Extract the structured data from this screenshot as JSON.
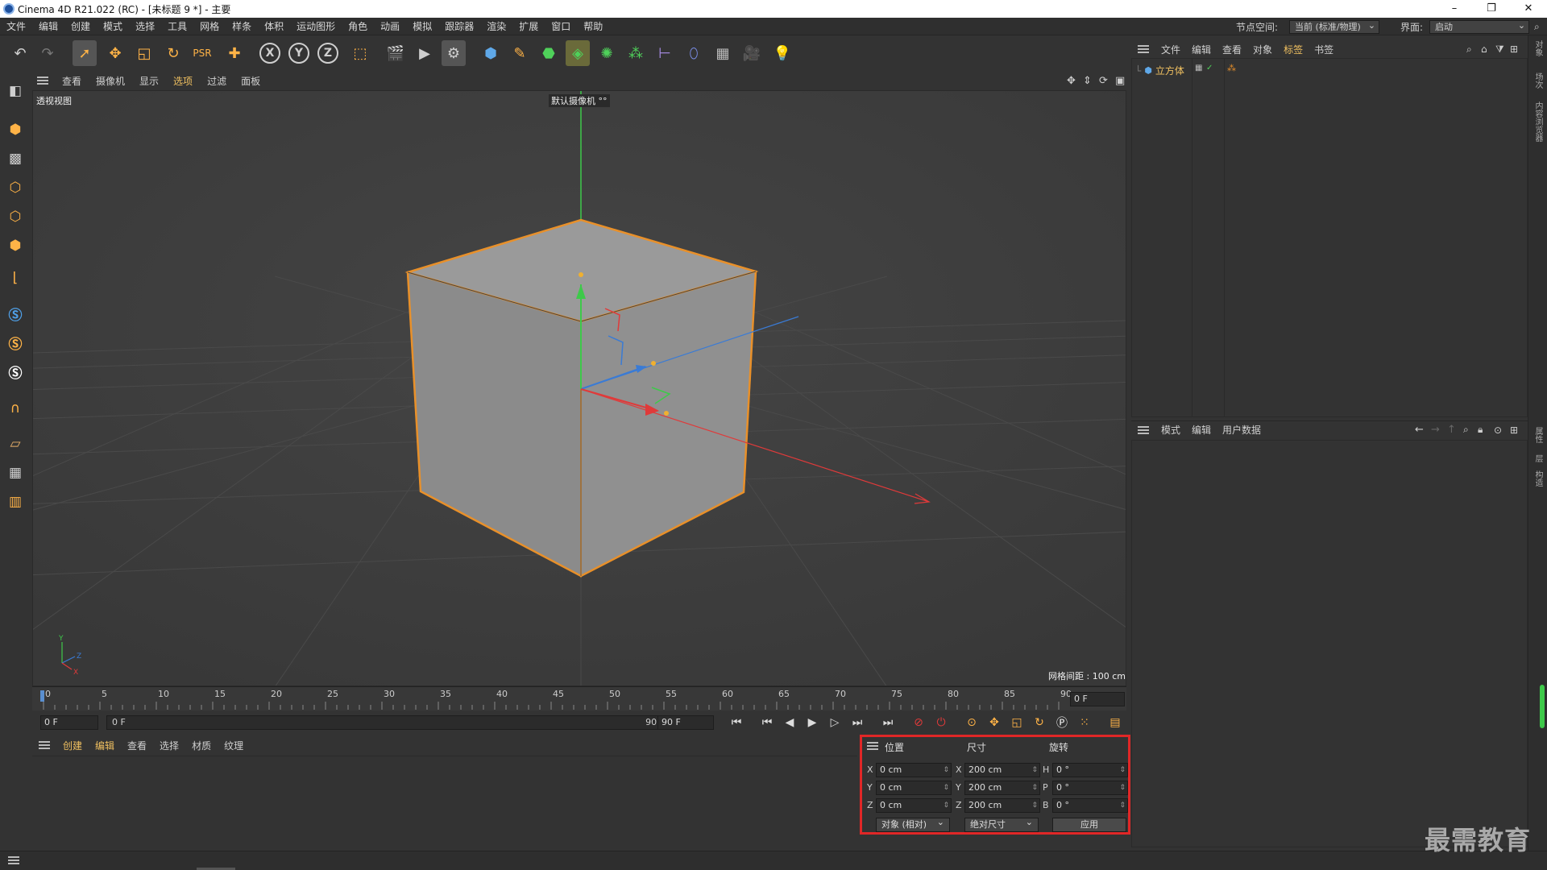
{
  "window": {
    "title": "Cinema 4D R21.022 (RC) - [未标题 9 *] - 主要",
    "minimize": "–",
    "restore": "❐",
    "close": "✕"
  },
  "menubar": {
    "items": [
      "文件",
      "编辑",
      "创建",
      "模式",
      "选择",
      "工具",
      "网格",
      "样条",
      "体积",
      "运动图形",
      "角色",
      "动画",
      "模拟",
      "跟踪器",
      "渲染",
      "扩展",
      "窗口",
      "帮助"
    ],
    "node_space_label": "节点空间:",
    "node_space_value": "当前 (标准/物理)",
    "layout_label": "界面:",
    "layout_value": "启动"
  },
  "viewport": {
    "menu": [
      "查看",
      "摄像机",
      "显示",
      "选项",
      "过滤",
      "面板"
    ],
    "view_name": "透视视图",
    "camera_name": "默认摄像机 °°",
    "grid_spacing": "网格间距 : 100 cm",
    "axis_labels": {
      "x": "X",
      "y": "Y",
      "z": "Z"
    }
  },
  "timeline": {
    "ticks": [
      "0",
      "5",
      "10",
      "15",
      "20",
      "25",
      "30",
      "35",
      "40",
      "45",
      "50",
      "55",
      "60",
      "65",
      "70",
      "75",
      "80",
      "85",
      "90"
    ],
    "current_frame": "0 F",
    "start_frame": "0 F",
    "range_start": "0 F",
    "range_end": "90 F",
    "end_frame": "90 F"
  },
  "material_menu": [
    "创建",
    "编辑",
    "查看",
    "选择",
    "材质",
    "纹理"
  ],
  "coordinates": {
    "headers": {
      "position": "位置",
      "size": "尺寸",
      "rotation": "旋转"
    },
    "rows": [
      {
        "axis": "X",
        "pos": "0 cm",
        "size_axis": "X",
        "size": "200 cm",
        "rot_axis": "H",
        "rot": "0 °"
      },
      {
        "axis": "Y",
        "pos": "0 cm",
        "size_axis": "Y",
        "size": "200 cm",
        "rot_axis": "P",
        "rot": "0 °"
      },
      {
        "axis": "Z",
        "pos": "0 cm",
        "size_axis": "Z",
        "size": "200 cm",
        "rot_axis": "B",
        "rot": "0 °"
      }
    ],
    "mode_dropdown": "对象 (相对)",
    "size_dropdown": "绝对尺寸",
    "apply_button": "应用",
    "highlight_color": "#e02727"
  },
  "object_manager": {
    "menu": [
      "文件",
      "编辑",
      "查看",
      "对象",
      "标签",
      "书签"
    ],
    "objects": [
      {
        "name": "立方体"
      }
    ]
  },
  "attribute_manager": {
    "menu": [
      "模式",
      "编辑",
      "用户数据"
    ]
  },
  "right_tabs": [
    "对象",
    "场次",
    "内容浏览器",
    "属性",
    "层",
    "构造"
  ],
  "watermark": "最需教育",
  "colors": {
    "accent_orange": "#e8902a",
    "axis_x": "#e03a3a",
    "axis_y": "#3ec94a",
    "axis_z": "#3a7bd5"
  }
}
